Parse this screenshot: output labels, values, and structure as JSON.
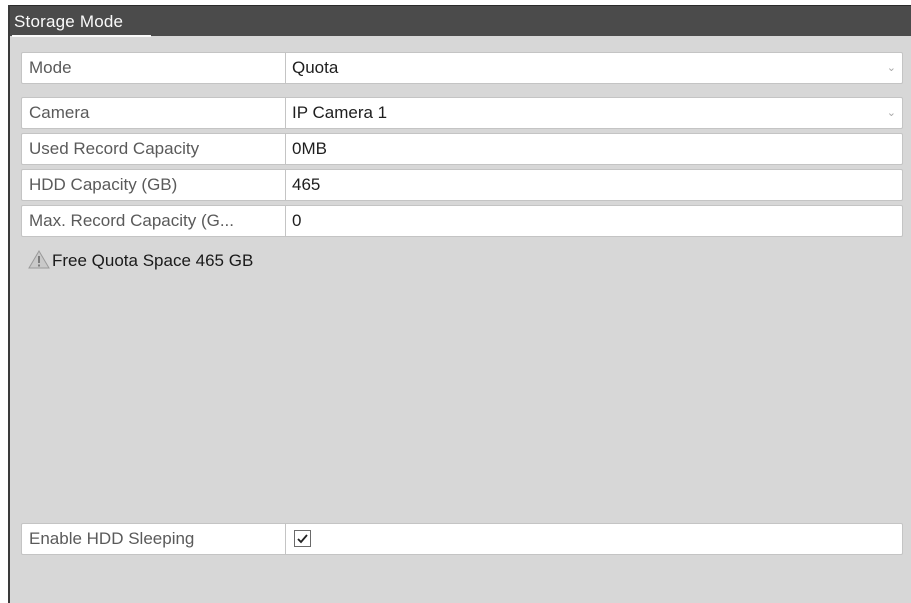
{
  "header": {
    "title": "Storage Mode"
  },
  "mode": {
    "label": "Mode",
    "value": "Quota"
  },
  "camera": {
    "label": "Camera",
    "value": "IP Camera 1"
  },
  "used_capacity": {
    "label": "Used Record Capacity",
    "value": "0MB"
  },
  "hdd_capacity": {
    "label": "HDD Capacity (GB)",
    "value": "465"
  },
  "max_capacity": {
    "label": "Max. Record Capacity (G...",
    "value": "0"
  },
  "warning": {
    "icon": "warning-icon",
    "text": "Free Quota Space 465 GB"
  },
  "hdd_sleeping": {
    "label": "Enable HDD Sleeping",
    "checked": true
  },
  "colors": {
    "title_bar": "#4b4b4b",
    "panel": "#d7d7d7",
    "field": "#ffffff"
  }
}
